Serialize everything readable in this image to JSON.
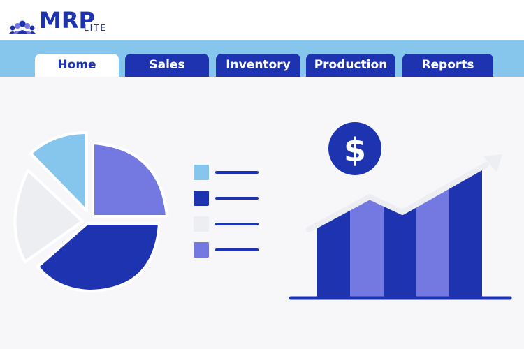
{
  "app": {
    "logo_main": "MRP",
    "logo_sub": "LITE"
  },
  "tabs": [
    {
      "label": "Home",
      "active": true
    },
    {
      "label": "Sales",
      "active": false
    },
    {
      "label": "Inventory",
      "active": false
    },
    {
      "label": "Production",
      "active": false
    },
    {
      "label": "Reports",
      "active": false
    }
  ],
  "icons": {
    "logo": "people-group-icon",
    "currency": "dollar-icon",
    "pie": "pie-chart-icon",
    "growth": "growth-chart-icon"
  },
  "currency_symbol": "$",
  "colors": {
    "brand": "#1e33b0",
    "light_blue": "#87c6ec",
    "lavender": "#7379e0",
    "light_gray": "#eceef1"
  },
  "legend": [
    {
      "color": "#87c6ec"
    },
    {
      "color": "#1e33b0"
    },
    {
      "color": "#eceef1"
    },
    {
      "color": "#7379e0"
    }
  ]
}
